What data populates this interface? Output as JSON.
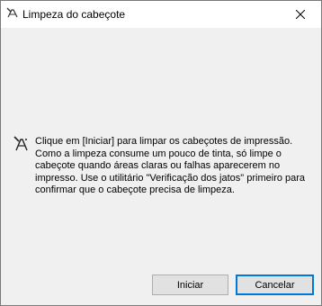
{
  "window": {
    "title": "Limpeza do cabeçote",
    "title_icon": "printer-head-cleaning-icon",
    "close_icon": "close-icon"
  },
  "dialog": {
    "message_icon": "head-cleaning-icon",
    "message": "Clique em [Iniciar] para limpar os cabeçotes de impressão. Como a limpeza consume um pouco de tinta, só limpe o cabeçote quando áreas claras ou falhas aparecerem no impresso. Use o utilitário \"Verificação dos jatos\" primeiro para confirmar que o cabeçote precisa de limpeza.",
    "buttons": {
      "start_label": "Iniciar",
      "cancel_label": "Cancelar"
    }
  },
  "colors": {
    "accent": "#0078d7",
    "button_bg": "#e1e1e1",
    "dialog_bg": "#f0f0f0"
  }
}
